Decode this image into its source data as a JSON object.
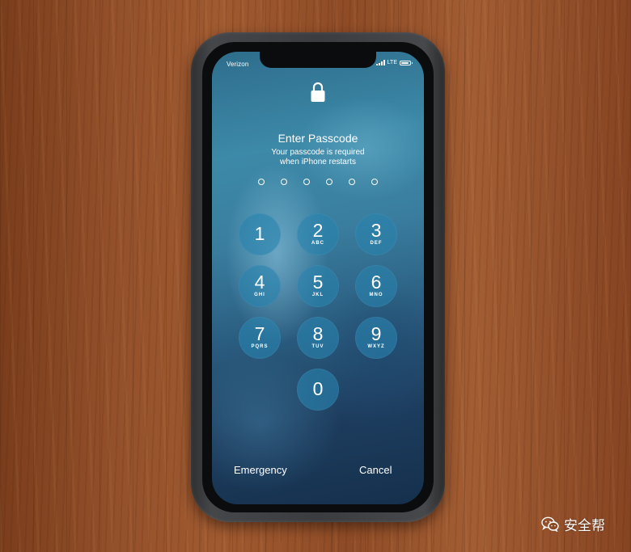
{
  "status_bar": {
    "carrier": "Verizon",
    "network": "LTE",
    "battery_level": 0.85
  },
  "lock_screen": {
    "icon": "lock-icon",
    "title": "Enter Passcode",
    "subtitle_line1": "Your passcode is required",
    "subtitle_line2": "when iPhone restarts",
    "passcode_dot_count": 6
  },
  "keypad": [
    {
      "digit": "1",
      "letters": ""
    },
    {
      "digit": "2",
      "letters": "ABC"
    },
    {
      "digit": "3",
      "letters": "DEF"
    },
    {
      "digit": "4",
      "letters": "GHI"
    },
    {
      "digit": "5",
      "letters": "JKL"
    },
    {
      "digit": "6",
      "letters": "MNO"
    },
    {
      "digit": "7",
      "letters": "PQRS"
    },
    {
      "digit": "8",
      "letters": "TUV"
    },
    {
      "digit": "9",
      "letters": "WXYZ"
    },
    {
      "digit": "0",
      "letters": ""
    }
  ],
  "bottom": {
    "emergency_label": "Emergency",
    "cancel_label": "Cancel"
  },
  "watermark": {
    "icon": "wechat-icon",
    "text": "安全帮"
  },
  "colors": {
    "key_fill": "#2882af",
    "text": "#ffffff",
    "wood": "#93502a"
  }
}
